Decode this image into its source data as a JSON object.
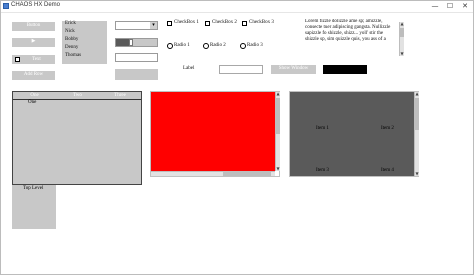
{
  "window": {
    "title": "CHAOS HX Demo",
    "controls": {
      "minimize": "—",
      "maximize": "☐",
      "close": "✕"
    }
  },
  "left_buttons": {
    "button_label": "Button",
    "play_glyph": "▶",
    "toggle_label": "Text",
    "disabled_label": "Add Row"
  },
  "names_list": [
    "Erick",
    "Nick",
    "Bobby",
    "Denny",
    "Thomas"
  ],
  "controls": {
    "stepper_value": "",
    "stepper_arrow": "▾",
    "slider_value": 0.35
  },
  "checkboxes": [
    {
      "label": "CheckBox 1",
      "checked": false
    },
    {
      "label": "CheckBox 2",
      "checked": false
    },
    {
      "label": "CheckBox 3",
      "checked": false
    }
  ],
  "radios": [
    {
      "label": "Radio 1",
      "selected": false
    },
    {
      "label": "Radio 2",
      "selected": false
    },
    {
      "label": "Radio 3",
      "selected": false
    }
  ],
  "label_row": {
    "label": "Label",
    "input_value": "",
    "show_window_label": "Show Window"
  },
  "text_area": {
    "text": "Lorem fizzle dolizzle ame sp; amizzle, consecte tuer adipiscing gangsta. Nullizzle sapizzle fo shizzle, shizz...  yoll' stir the shizzle sp, sim quizzle quis, you ass of a"
  },
  "table": {
    "columns": [
      "One",
      "Two",
      "Three"
    ],
    "rows": [
      [
        "One",
        "",
        ""
      ]
    ],
    "footer_label": "Top Level"
  },
  "grid_panel": {
    "items": [
      "Item 1",
      "Item 2",
      "Item 3",
      "Item 4"
    ]
  },
  "colors": {
    "red_panel": "#ff0000",
    "dark_panel": "#5a5a5a",
    "black_box": "#000000",
    "button_gray": "#c8c8c8"
  }
}
